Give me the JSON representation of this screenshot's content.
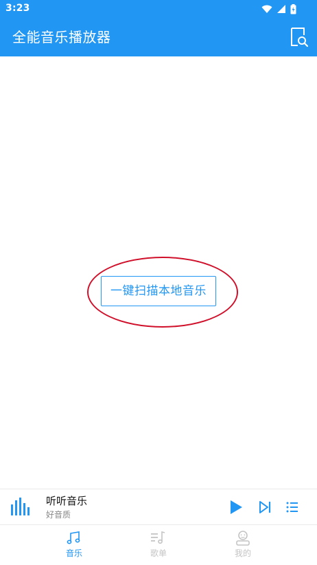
{
  "status_bar": {
    "time": "3:23"
  },
  "app_bar": {
    "title": "全能音乐播放器"
  },
  "main": {
    "scan_button_label": "一键扫描本地音乐"
  },
  "player": {
    "title": "听听音乐",
    "subtitle": "好音质"
  },
  "bottom_nav": {
    "items": [
      {
        "label": "音乐",
        "icon": "music-note-icon",
        "active": true
      },
      {
        "label": "歌单",
        "icon": "playlist-icon",
        "active": false
      },
      {
        "label": "我的",
        "icon": "profile-icon",
        "active": false
      }
    ]
  },
  "colors": {
    "primary": "#2196f3",
    "highlight_ring": "#d0102a",
    "inactive": "#c4c4c4"
  }
}
